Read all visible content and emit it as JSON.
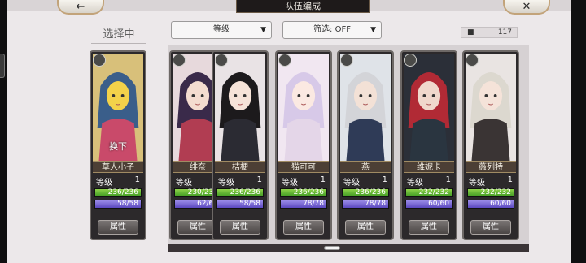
{
  "header": {
    "title": "队伍编成",
    "back_icon": "←",
    "close_icon": "✕"
  },
  "selected_label": "选择中",
  "sort_dropdown": {
    "value": "等级",
    "arrow": "▼"
  },
  "filter_dropdown": {
    "value": "筛选: OFF",
    "arrow": "▼"
  },
  "count": {
    "icon": "person-icon",
    "value": "117"
  },
  "labels": {
    "level": "等级",
    "attr_button": "属性",
    "swap": "换下"
  },
  "selected_card": {
    "name": "草人小子",
    "level": "1",
    "hp": "236/236",
    "mp": "58/58",
    "hp_fill": 1.0,
    "mp_fill": 1.0,
    "palette": {
      "bg": "#d8c07a",
      "hair": "#3a5e8a",
      "skin": "#f3d24a",
      "cloth": "#c94a6a"
    }
  },
  "cards": [
    {
      "name": "绯奈",
      "level": "1",
      "hp": "230/230",
      "mp": "62/62",
      "hp_fill": 1.0,
      "mp_fill": 1.0,
      "palette": {
        "bg": "#e7d9dc",
        "hair": "#3a2a4a",
        "skin": "#f4dcd0",
        "cloth": "#b13d52"
      }
    },
    {
      "name": "桔梗",
      "level": "1",
      "hp": "236/236",
      "mp": "58/58",
      "hp_fill": 1.0,
      "mp_fill": 1.0,
      "palette": {
        "bg": "#e9e3e5",
        "hair": "#1c1a1c",
        "skin": "#f6e3d8",
        "cloth": "#2b2b33"
      }
    },
    {
      "name": "猫可可",
      "level": "1",
      "hp": "236/236",
      "mp": "78/78",
      "hp_fill": 1.0,
      "mp_fill": 1.0,
      "palette": {
        "bg": "#f1e7f1",
        "hair": "#d7c9e8",
        "skin": "#fbe9e2",
        "cloth": "#e4d6e8"
      }
    },
    {
      "name": "燕",
      "level": "1",
      "hp": "236/236",
      "mp": "78/78",
      "hp_fill": 1.0,
      "mp_fill": 1.0,
      "palette": {
        "bg": "#dfe3e8",
        "hair": "#d3d4d8",
        "skin": "#f3e1d6",
        "cloth": "#2f3b57"
      }
    },
    {
      "name": "维妮卡",
      "level": "1",
      "hp": "232/232",
      "mp": "60/60",
      "hp_fill": 1.0,
      "mp_fill": 1.0,
      "palette": {
        "bg": "#2b2f38",
        "hair": "#b12a35",
        "skin": "#f0d8cc",
        "cloth": "#2a3540"
      }
    },
    {
      "name": "薇列特",
      "level": "1",
      "hp": "232/232",
      "mp": "60/60",
      "hp_fill": 1.0,
      "mp_fill": 1.0,
      "palette": {
        "bg": "#e9e4e2",
        "hair": "#dcd8cf",
        "skin": "#f5e3d9",
        "cloth": "#3a3434"
      }
    }
  ]
}
